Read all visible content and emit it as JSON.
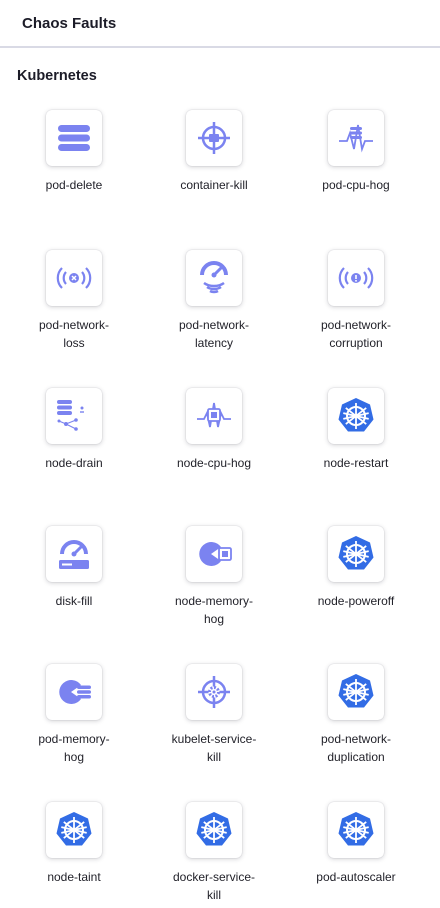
{
  "header": {
    "title": "Chaos Faults"
  },
  "section": {
    "title": "Kubernetes"
  },
  "colors": {
    "accent": "#7b83f0",
    "k8s": "#326ce5",
    "border": "#d9dae5"
  },
  "faults": [
    {
      "label": "pod-delete",
      "icon": "stack-icon"
    },
    {
      "label": "container-kill",
      "icon": "crosshair-icon"
    },
    {
      "label": "pod-cpu-hog",
      "icon": "cpu-pulse-icon"
    },
    {
      "label": "pod-network-\nloss",
      "icon": "network-loss-icon"
    },
    {
      "label": "pod-network-\nlatency",
      "icon": "gauge-wifi-icon"
    },
    {
      "label": "pod-network-\ncorruption",
      "icon": "network-corruption-icon"
    },
    {
      "label": "node-drain",
      "icon": "node-drain-icon"
    },
    {
      "label": "node-cpu-hog",
      "icon": "chip-pulse-icon"
    },
    {
      "label": "node-restart",
      "icon": "kubernetes-icon"
    },
    {
      "label": "disk-fill",
      "icon": "gauge-disk-icon"
    },
    {
      "label": "node-memory-\nhog",
      "icon": "pacman-chip-icon"
    },
    {
      "label": "node-poweroff",
      "icon": "kubernetes-icon"
    },
    {
      "label": "pod-memory-\nhog",
      "icon": "pacman-stack-icon"
    },
    {
      "label": "kubelet-service-\nkill",
      "icon": "crosshair-gear-icon"
    },
    {
      "label": "pod-network-\nduplication",
      "icon": "kubernetes-icon"
    },
    {
      "label": "node-taint",
      "icon": "kubernetes-icon"
    },
    {
      "label": "docker-service-\nkill",
      "icon": "kubernetes-icon"
    },
    {
      "label": "pod-autoscaler",
      "icon": "kubernetes-icon"
    }
  ]
}
